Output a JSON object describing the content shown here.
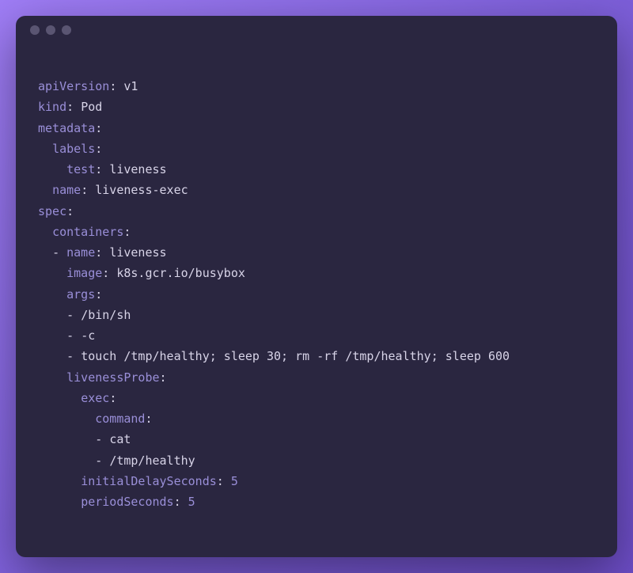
{
  "colors": {
    "background_gradient_start": "#9f7df5",
    "background_gradient_end": "#6d4dc7",
    "window_bg": "#2a2640",
    "dot_inactive": "#5a5572",
    "key_color": "#9a8fd8",
    "text_color": "#d8d4e8"
  },
  "yaml": {
    "apiVersion": {
      "key": "apiVersion",
      "value": "v1"
    },
    "kind": {
      "key": "kind",
      "value": "Pod"
    },
    "metadata": {
      "key": "metadata",
      "labels": {
        "key": "labels",
        "test": {
          "key": "test",
          "value": "liveness"
        }
      },
      "name": {
        "key": "name",
        "value": "liveness-exec"
      }
    },
    "spec": {
      "key": "spec",
      "containers": {
        "key": "containers",
        "item": {
          "name": {
            "key": "name",
            "value": "liveness"
          },
          "image": {
            "key": "image",
            "value": "k8s.gcr.io/busybox"
          },
          "args": {
            "key": "args",
            "values": [
              "/bin/sh",
              "-c",
              "touch /tmp/healthy; sleep 30; rm -rf /tmp/healthy; sleep 600"
            ]
          },
          "livenessProbe": {
            "key": "livenessProbe",
            "exec": {
              "key": "exec",
              "command": {
                "key": "command",
                "values": [
                  "cat",
                  "/tmp/healthy"
                ]
              }
            },
            "initialDelaySeconds": {
              "key": "initialDelaySeconds",
              "value": "5"
            },
            "periodSeconds": {
              "key": "periodSeconds",
              "value": "5"
            }
          }
        }
      }
    }
  }
}
